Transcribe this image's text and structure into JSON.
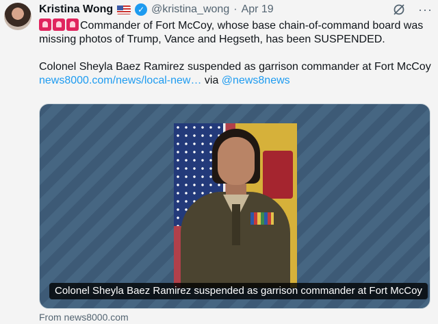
{
  "author": {
    "name": "Kristina Wong",
    "handle": "@kristina_wong",
    "separator": "·",
    "date": "Apr 19"
  },
  "icons": {
    "flag": "us-flag-icon",
    "verified": "verified-badge-icon",
    "grok": "grok-icon",
    "more": "more-icon",
    "siren": "police-light-icon"
  },
  "tweet": {
    "line1": "Commander of Fort McCoy, whose base chain-of-command board was missing photos of Trump, Vance and Hegseth, has been SUSPENDED.",
    "line2_prefix": "Colonel Sheyla Baez Ramirez suspended as garrison commander at Fort McCoy ",
    "link": "news8000.com/news/local-new…",
    "via_text": " via ",
    "mention": "@news8news"
  },
  "card": {
    "caption": "Colonel Sheyla Baez Ramirez suspended as garrison commander at Fort McCoy",
    "source": "From news8000.com"
  },
  "colors": {
    "link": "#1d9bf0",
    "muted": "#536471",
    "card_bg": "#3d5a76"
  }
}
